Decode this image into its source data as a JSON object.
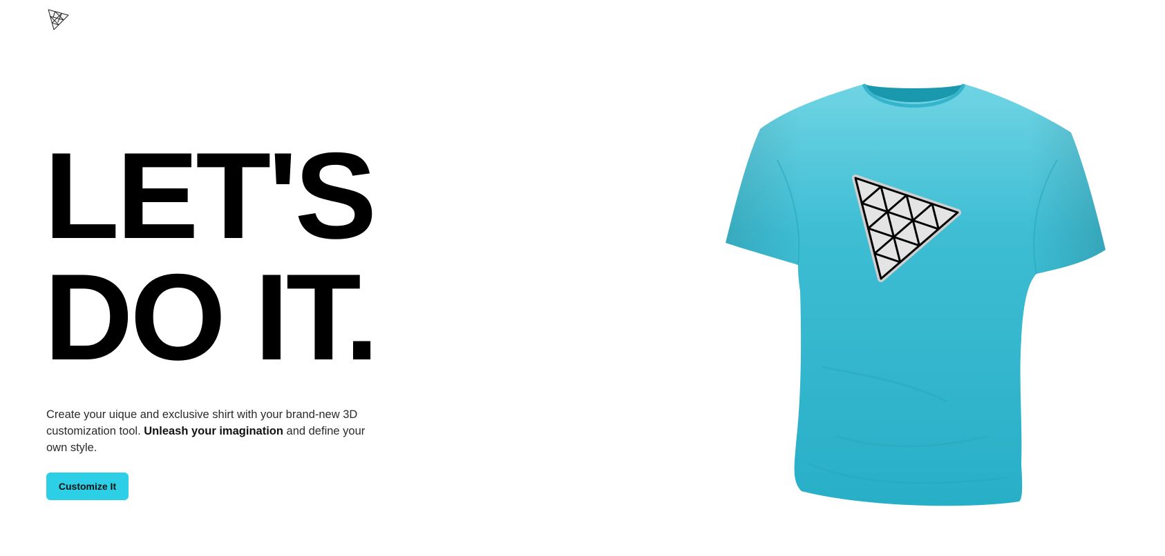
{
  "logo": {
    "icon": "triangle-grid-logo-icon"
  },
  "hero": {
    "title_line1": "LET'S",
    "title_line2": "DO IT.",
    "description_start": "Create your uique and exclusive shirt with your brand-new 3D customization tool. ",
    "description_bold": "Unleash your imagination",
    "description_end": " and define your own style.",
    "cta_label": "Customize It"
  },
  "product": {
    "icon": "t-shirt-image",
    "decal_icon": "triangle-grid-logo-icon",
    "shirt_color": "#2fb9d0"
  },
  "theme": {
    "accent": "#2ccfe6"
  }
}
